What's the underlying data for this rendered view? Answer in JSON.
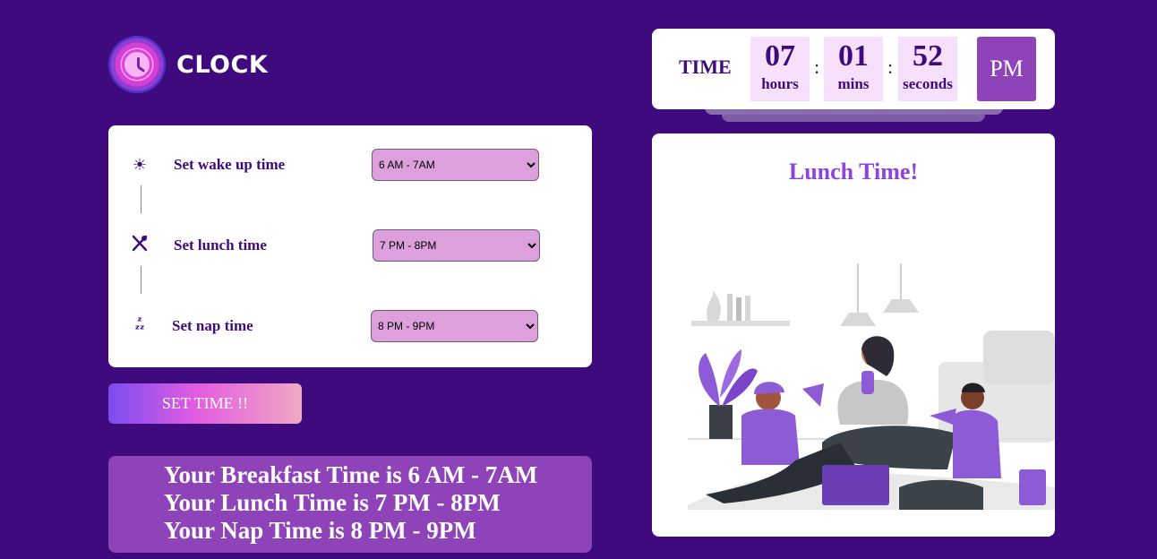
{
  "app": {
    "logo_text": "CLOCK"
  },
  "settings": {
    "wake": {
      "label": "Set wake up time",
      "selected": "6 AM - 7AM",
      "icon": "sun-icon"
    },
    "lunch": {
      "label": "Set lunch time",
      "selected": "7 PM - 8PM",
      "icon": "utensils-icon"
    },
    "nap": {
      "label": "Set nap time",
      "selected": "8 PM - 9PM",
      "icon": "sleep-icon"
    }
  },
  "button": {
    "label": "SET TIME !!"
  },
  "summary": {
    "breakfast": "Your Breakfast Time is 6 AM - 7AM",
    "lunch": "Your Lunch Time is 7 PM - 8PM",
    "nap": "Your Nap Time is 8 PM - 9PM"
  },
  "clock": {
    "label": "TIME",
    "hours": "07",
    "hours_unit": "hours",
    "mins": "01",
    "mins_unit": "mins",
    "seconds": "52",
    "seconds_unit": "seconds",
    "separator": ":",
    "ampm": "PM"
  },
  "illustration": {
    "title": "Lunch Time!"
  },
  "colors": {
    "background": "#3e0a7e",
    "accent": "#8e44b8",
    "select_bg": "#dda0dd",
    "title": "#8e44d8"
  }
}
